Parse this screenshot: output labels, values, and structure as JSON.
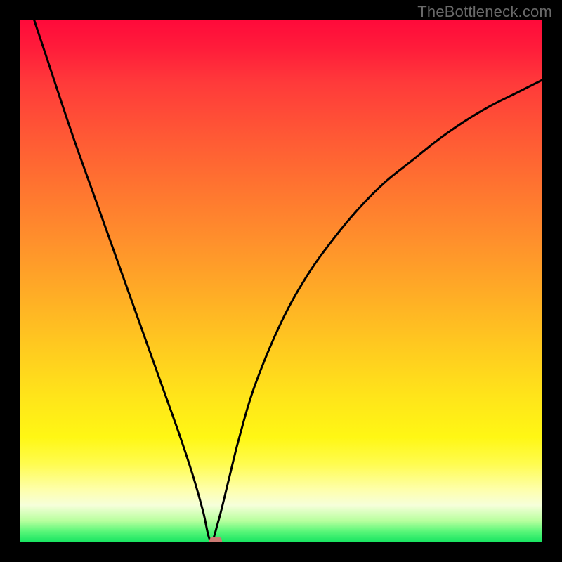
{
  "watermark": {
    "text": "TheBottleneck.com"
  },
  "colors": {
    "curve": "#000000",
    "marker": "#cb7a73",
    "frame": "#000000"
  },
  "chart_data": {
    "type": "line",
    "title": "",
    "xlabel": "",
    "ylabel": "",
    "xlim": [
      0,
      100
    ],
    "ylim": [
      0,
      100
    ],
    "grid": false,
    "description": "V-shaped bottleneck curve on red→green vertical gradient; minimum near x≈36.",
    "series": [
      {
        "name": "bottleneck-curve",
        "x": [
          0,
          5,
          10,
          15,
          20,
          25,
          30,
          33,
          35,
          36.5,
          38,
          40,
          42,
          45,
          50,
          55,
          60,
          65,
          70,
          75,
          80,
          85,
          90,
          95,
          100
        ],
        "values": [
          108,
          93,
          78,
          64,
          50,
          36,
          22,
          13,
          6,
          0.2,
          4,
          12,
          20,
          30,
          42,
          51,
          58,
          64,
          69,
          73,
          77,
          80.5,
          83.5,
          86,
          88.5
        ]
      }
    ],
    "marker": {
      "x": 37.5,
      "y": 0.2
    },
    "legend": false,
    "annotations": []
  }
}
